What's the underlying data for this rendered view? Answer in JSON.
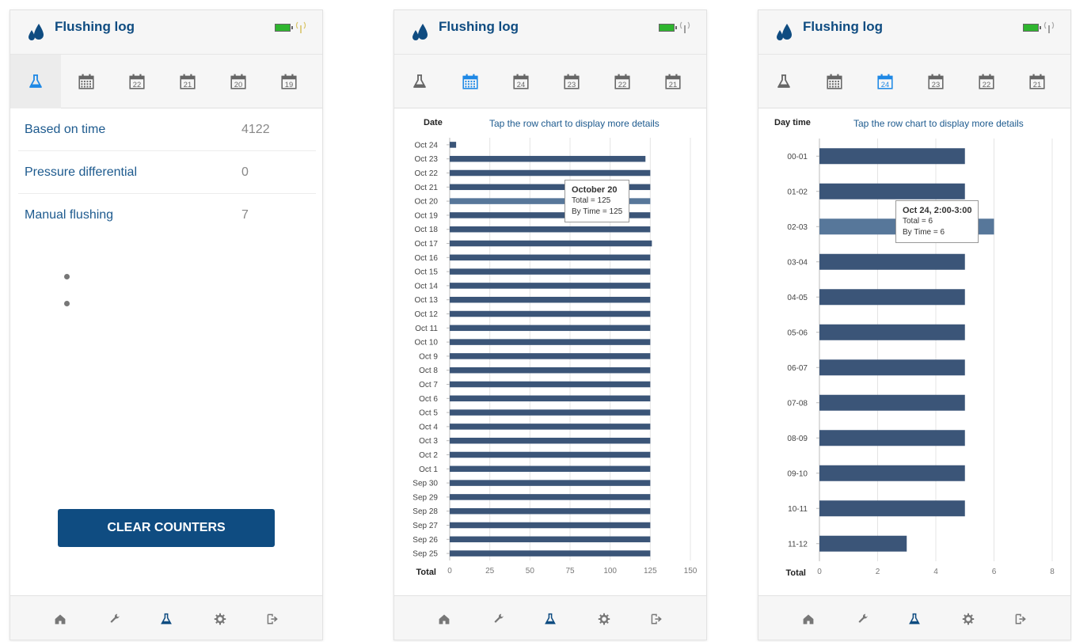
{
  "app": {
    "title": "Flushing log"
  },
  "colors": {
    "brand": "#0f4c81",
    "bar": "#3b5578",
    "bar_highlight": "#57779a",
    "active_tab": "#1e88e5",
    "battery": "#2fb52f"
  },
  "icons": {
    "drops": "water-drops-icon",
    "flask": "flask-icon",
    "calendar": "calendar-icon",
    "home": "home-icon",
    "wrench": "wrench-icon",
    "gear": "gear-icon",
    "logout": "logout-icon"
  },
  "panel1": {
    "tabs": [
      "",
      "",
      "22",
      "21",
      "20",
      "19"
    ],
    "counters": [
      {
        "label": "Based on time",
        "value": "4122"
      },
      {
        "label": "Pressure differential",
        "value": "0"
      },
      {
        "label": "Manual flushing",
        "value": "7"
      }
    ],
    "clear_button": "CLEAR COUNTERS"
  },
  "panel2": {
    "tabs": [
      "",
      "",
      "24",
      "23",
      "22",
      "21"
    ],
    "left_header": "Date",
    "hint": "Tap the row chart to display more details",
    "tooltip": {
      "title": "October 20",
      "line1": "Total = 125",
      "line2": "By Time = 125"
    }
  },
  "panel3": {
    "tabs": [
      "",
      "",
      "24",
      "23",
      "22",
      "21"
    ],
    "left_header": "Day time",
    "hint": "Tap the row chart to display more details",
    "tooltip": {
      "title": "Oct 24, 2:00-3:00",
      "line1": "Total = 6",
      "line2": "By Time = 6"
    }
  },
  "chart_data": [
    {
      "type": "bar",
      "orientation": "horizontal",
      "ylabel": "Date",
      "xlabel": "Total",
      "categories": [
        "Oct 24",
        "Oct 23",
        "Oct 22",
        "Oct 21",
        "Oct 20",
        "Oct 19",
        "Oct 18",
        "Oct 17",
        "Oct 16",
        "Oct 15",
        "Oct 14",
        "Oct 13",
        "Oct 12",
        "Oct 11",
        "Oct 10",
        "Oct 9",
        "Oct 8",
        "Oct 7",
        "Oct 6",
        "Oct 5",
        "Oct 4",
        "Oct 3",
        "Oct 2",
        "Oct 1",
        "Sep 30",
        "Sep 29",
        "Sep 28",
        "Sep 27",
        "Sep 26",
        "Sep 25"
      ],
      "values": [
        4,
        122,
        125,
        125,
        125,
        125,
        125,
        126,
        125,
        125,
        125,
        125,
        125,
        125,
        125,
        125,
        125,
        125,
        125,
        125,
        125,
        125,
        125,
        125,
        125,
        125,
        125,
        125,
        125,
        125
      ],
      "xlim": [
        0,
        150
      ],
      "xticks": [
        "0",
        "25",
        "50",
        "75",
        "100",
        "125",
        "150"
      ],
      "highlight": "Oct 20",
      "grid": true
    },
    {
      "type": "bar",
      "orientation": "horizontal",
      "ylabel": "Day time",
      "xlabel": "Total",
      "categories": [
        "00-01",
        "01-02",
        "02-03",
        "03-04",
        "04-05",
        "05-06",
        "06-07",
        "07-08",
        "08-09",
        "09-10",
        "10-11",
        "11-12"
      ],
      "values": [
        5,
        5,
        6,
        5,
        5,
        5,
        5,
        5,
        5,
        5,
        5,
        3
      ],
      "xlim": [
        0,
        8
      ],
      "xticks": [
        "0",
        "2",
        "4",
        "6",
        "8"
      ],
      "highlight": "02-03",
      "grid": true
    }
  ]
}
